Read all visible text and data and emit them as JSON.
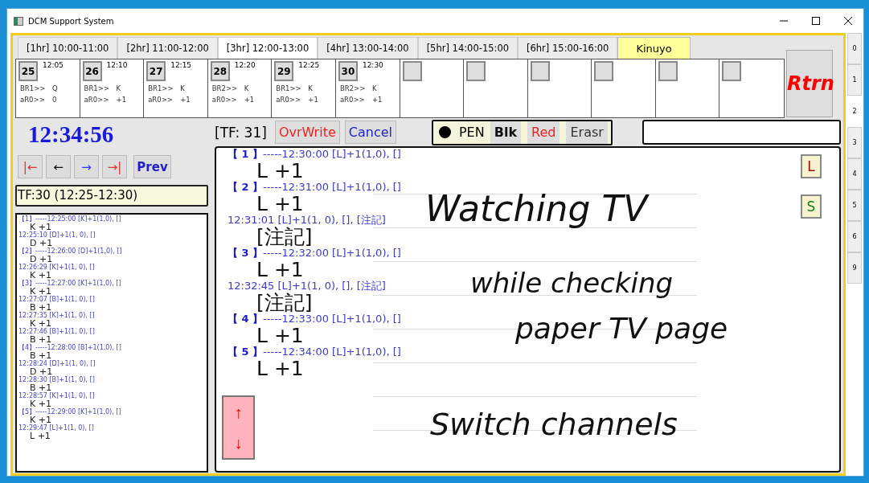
{
  "window": {
    "title": "DCM Support System"
  },
  "hour_tabs": [
    {
      "label": "[1hr] 10:00-11:00",
      "selected": false
    },
    {
      "label": "[2hr] 11:00-12:00",
      "selected": false
    },
    {
      "label": "[3hr] 12:00-13:00",
      "selected": true
    },
    {
      "label": "[4hr] 13:00-14:00",
      "selected": false
    },
    {
      "label": "[5hr] 14:00-15:00",
      "selected": false
    },
    {
      "label": "[6hr] 15:00-16:00",
      "selected": false
    }
  ],
  "user_tab": {
    "label": "Kinuyo"
  },
  "frames": [
    {
      "kind": "filled",
      "number": "25",
      "time": "12:05",
      "row_1_label": "BR1>>",
      "row_1_value": "Q",
      "row_2_label": "aR0>>",
      "row_2_value": "0"
    },
    {
      "kind": "filled",
      "number": "26",
      "time": "12:10",
      "row_1_label": "BR1>>",
      "row_1_value": "K",
      "row_2_label": "aR0>>",
      "row_2_value": "+1"
    },
    {
      "kind": "filled",
      "number": "27",
      "time": "12:15",
      "row_1_label": "BR1>>",
      "row_1_value": "K",
      "row_2_label": "aR0>>",
      "row_2_value": "+1"
    },
    {
      "kind": "filled",
      "number": "28",
      "time": "12:20",
      "row_1_label": "BR2>>",
      "row_1_value": "K",
      "row_2_label": "aR0>>",
      "row_2_value": "+1"
    },
    {
      "kind": "filled",
      "number": "29",
      "time": "12:25",
      "row_1_label": "BR1>>",
      "row_1_value": "K",
      "row_2_label": "aR0>>",
      "row_2_value": "+1"
    },
    {
      "kind": "filled",
      "number": "30",
      "time": "12:30",
      "row_1_label": "BR2>>",
      "row_1_value": "K",
      "row_2_label": "aR0>>",
      "row_2_value": "+1"
    },
    {
      "kind": "empty"
    },
    {
      "kind": "empty"
    },
    {
      "kind": "empty"
    },
    {
      "kind": "empty"
    },
    {
      "kind": "empty"
    },
    {
      "kind": "empty"
    }
  ],
  "return_button": {
    "label": "Rtrn"
  },
  "side_tabs": [
    {
      "label": "0",
      "selected": false
    },
    {
      "label": "1",
      "selected": false
    },
    {
      "label": "2",
      "selected": true
    },
    {
      "label": "3",
      "selected": false
    },
    {
      "label": "4",
      "selected": false
    },
    {
      "label": "5",
      "selected": false
    },
    {
      "label": "6",
      "selected": false
    },
    {
      "label": "9",
      "selected": false
    }
  ],
  "clock": "12:34:56",
  "nav_buttons": [
    {
      "kind": "first",
      "label": "|←"
    },
    {
      "kind": "back",
      "label": "←"
    },
    {
      "kind": "forward",
      "label": "→"
    },
    {
      "kind": "last",
      "label": "→|"
    },
    {
      "kind": "prev",
      "label": "Prev"
    }
  ],
  "current_frame": "[TF: 31]",
  "overwrite_button": {
    "label": "OvrWrite"
  },
  "cancel_button": {
    "label": "Cancel"
  },
  "pen_tools": [
    {
      "kind": "pen",
      "label": "PEN",
      "selected": false
    },
    {
      "kind": "black",
      "label": "Blk",
      "selected": true
    },
    {
      "kind": "red",
      "label": "Red",
      "selected": false
    },
    {
      "kind": "eraser",
      "label": "Erasr",
      "selected": false
    }
  ],
  "previous_frame": "TF:30 (12:25-12:30)",
  "previous_log": [
    {
      "header": "【1】-----12:25:00 [K]+1(1,0), []",
      "entry": "K +1"
    },
    {
      "header": "12:25:10 [D]+1(1, 0), []",
      "entry": "D +1"
    },
    {
      "header": "【2】-----12:26:00 [D]+1(1,0), []",
      "entry": "D +1"
    },
    {
      "header": "12:26:29 [K]+1(1, 0), []",
      "entry": "K +1"
    },
    {
      "header": "【3】-----12:27:00 [K]+1(1,0), []",
      "entry": "K +1"
    },
    {
      "header": "12:27:07 [B]+1(1, 0), []",
      "entry": "B +1"
    },
    {
      "header": "12:27:35 [K]+1(1, 0), []",
      "entry": "K +1"
    },
    {
      "header": "12:27:46 [B]+1(1, 0), []",
      "entry": "B +1"
    },
    {
      "header": "【4】-----12:28:00 [B]+1(1,0), []",
      "entry": "B +1"
    },
    {
      "header": "12:28:24 [D]+1(1, 0), []",
      "entry": "D +1"
    },
    {
      "header": "12:28:30 [B]+1(1, 0), []",
      "entry": "B +1"
    },
    {
      "header": "12:28:57 [K]+1(1, 0), []",
      "entry": "K +1"
    },
    {
      "header": "【5】-----12:29:00 [K]+1(1,0), []",
      "entry": "K +1"
    },
    {
      "header": "12:29:47 [L]+1(1, 0), []",
      "entry": "L +1"
    }
  ],
  "log": [
    {
      "header": "**【 1 】**-----12:30:00 [L]+1(1,0), []",
      "entry": "L +1"
    },
    {
      "header": "**【 2 】**-----12:31:00 [L]+1(1,0), []",
      "entry": "L +1"
    },
    {
      "header": "12:31:01 [L]+1(1, 0), [], [注記]",
      "entry": "[注記]"
    },
    {
      "header": "**【 3 】**-----12:32:00 [L]+1(1,0), []",
      "entry": "L +1"
    },
    {
      "header": "12:32:45 [L]+1(1, 0), [], [注記]",
      "entry": "[注記]"
    },
    {
      "header": "**【 4 】**-----12:33:00 [L]+1(1,0), []",
      "entry": "L +1"
    },
    {
      "header": "**【 5 】**-----12:34:00 [L]+1(1,0), []",
      "entry": "L +1"
    }
  ],
  "side_buttons": [
    {
      "label": "L"
    },
    {
      "label": "S"
    }
  ],
  "scroll_button": {
    "up": "↑",
    "down": "↓"
  },
  "handwriting": [
    "Watching TV",
    "while checking",
    "paper TV page",
    "Switch channels"
  ]
}
